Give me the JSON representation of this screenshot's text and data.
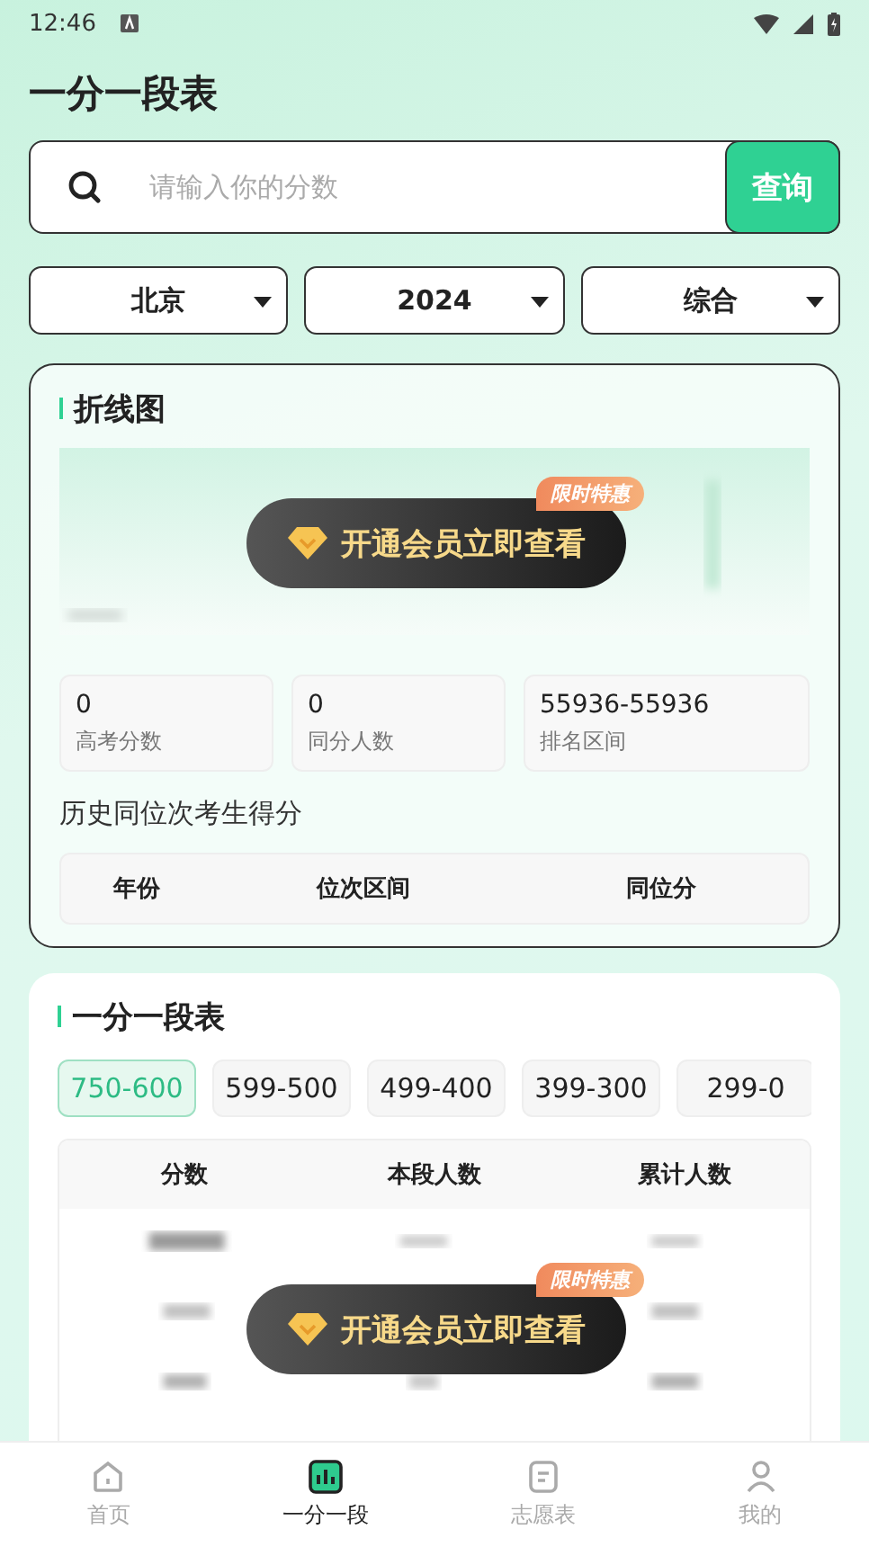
{
  "status_bar": {
    "time": "12:46"
  },
  "title": "一分一段表",
  "search": {
    "placeholder": "请输入你的分数",
    "button": "查询"
  },
  "filters": [
    {
      "label": "北京"
    },
    {
      "label": "2024"
    },
    {
      "label": "综合"
    }
  ],
  "chart_card": {
    "title": "折线图",
    "vip_button": {
      "label": "开通会员立即查看",
      "badge": "限时特惠"
    },
    "stats": [
      {
        "value": "0",
        "label": "高考分数"
      },
      {
        "value": "0",
        "label": "同分人数"
      },
      {
        "value": "55936-55936",
        "label": "排名区间"
      }
    ],
    "history_title": "历史同位次考生得分",
    "history_columns": [
      "年份",
      "位次区间",
      "同位分"
    ]
  },
  "table_card": {
    "title": "一分一段表",
    "ranges": [
      {
        "label": "750-600",
        "selected": true
      },
      {
        "label": "599-500",
        "selected": false
      },
      {
        "label": "499-400",
        "selected": false
      },
      {
        "label": "399-300",
        "selected": false
      },
      {
        "label": "299-0",
        "selected": false
      }
    ],
    "columns": [
      "分数",
      "本段人数",
      "累计人数"
    ],
    "vip_button": {
      "label": "开通会员立即查看",
      "badge": "限时特惠"
    }
  },
  "nav": [
    {
      "label": "首页",
      "selected": false
    },
    {
      "label": "一分一段",
      "selected": true
    },
    {
      "label": "志愿表",
      "selected": false
    },
    {
      "label": "我的",
      "selected": false
    }
  ]
}
